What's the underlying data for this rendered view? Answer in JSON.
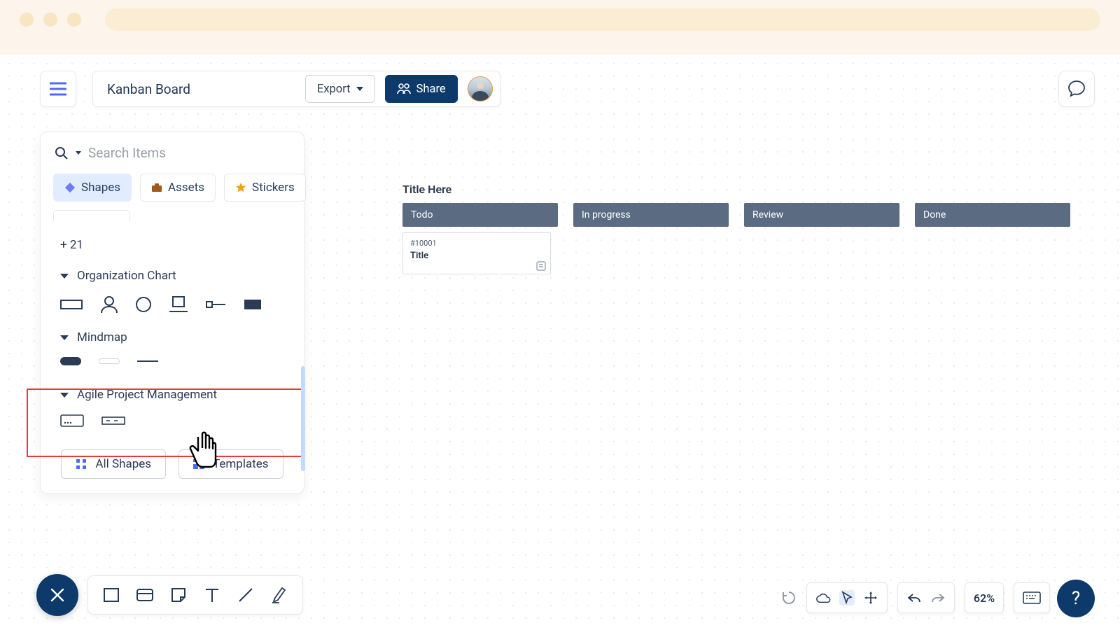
{
  "header": {
    "title": "Kanban Board",
    "export_label": "Export",
    "share_label": "Share"
  },
  "search": {
    "placeholder": "Search Items"
  },
  "tabs": {
    "shapes": "Shapes",
    "assets": "Assets",
    "stickers": "Stickers"
  },
  "captions": {
    "more_count": "+ 21",
    "sect_org": "Organization Chart",
    "sect_mind": "Mindmap",
    "sect_agile": "Agile Project Management",
    "all_shapes": "All Shapes",
    "templates": "Templates"
  },
  "kanban": {
    "title": "Title Here",
    "columns": [
      {
        "label": "Todo"
      },
      {
        "label": "In progress"
      },
      {
        "label": "Review"
      },
      {
        "label": "Done"
      }
    ],
    "card": {
      "id": "#10001",
      "title": "Title"
    }
  },
  "footer": {
    "zoom": "62%",
    "help": "?"
  },
  "colors": {
    "accent": "#0d3a6b",
    "highlight_border": "#e33b3b"
  }
}
